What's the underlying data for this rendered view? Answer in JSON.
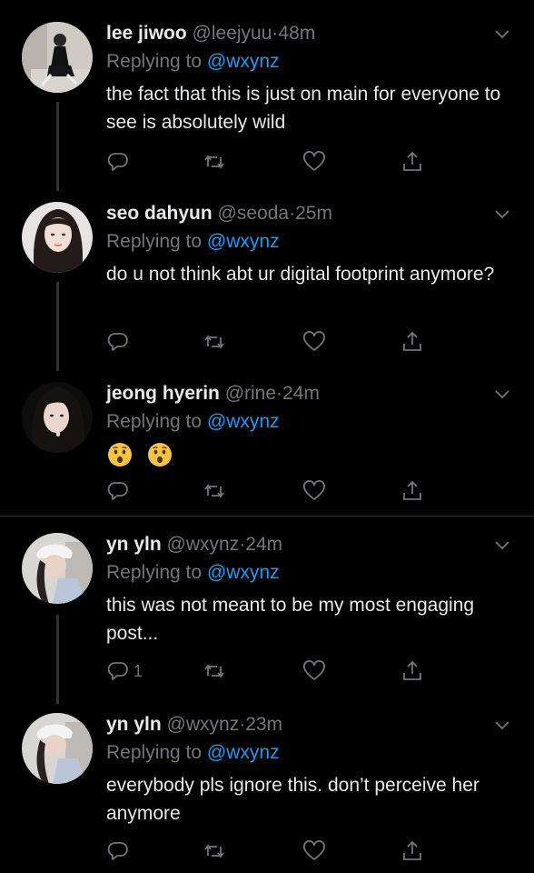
{
  "tweets": [
    {
      "name": "lee jiwoo",
      "handle": "@leejyuu",
      "dot": "·",
      "time": "48m",
      "replying_prefix": "Replying to ",
      "replying_to": "@wxynz",
      "text": "the fact that this is just on main for everyone to see is absolutely wild",
      "reply_count": ""
    },
    {
      "name": "seo dahyun",
      "handle": "@seoda",
      "dot": "·",
      "time": "25m",
      "replying_prefix": "Replying to ",
      "replying_to": "@wxynz",
      "text": "do u not think abt ur digital footprint anymore?",
      "reply_count": ""
    },
    {
      "name": "jeong hyerin",
      "handle": "@rine",
      "dot": "·",
      "time": "24m",
      "replying_prefix": "Replying to ",
      "replying_to": "@wxynz",
      "emojis": [
        "astonished-face-emoji",
        "astonished-face-emoji"
      ],
      "reply_count": ""
    },
    {
      "name": "yn yln",
      "handle": "@wxynz",
      "dot": "·",
      "time": "24m",
      "replying_prefix": "Replying to ",
      "replying_to": "@wxynz",
      "text": "this was not meant to be my most engaging post...",
      "reply_count": "1"
    },
    {
      "name": "yn yln",
      "handle": "@wxynz",
      "dot": "·",
      "time": "23m",
      "replying_prefix": "Replying to ",
      "replying_to": "@wxynz",
      "text": "everybody pls ignore this. don’t perceive her anymore",
      "reply_count": ""
    }
  ],
  "icons": {
    "reply": "reply-icon",
    "retweet": "retweet-icon",
    "like": "heart-icon",
    "share": "share-icon",
    "more": "chevron-down-icon"
  },
  "colors": {
    "background": "#000000",
    "text": "#e7e9ea",
    "muted": "#71767b",
    "link": "#1d9bf0",
    "divider": "#2f3336"
  }
}
